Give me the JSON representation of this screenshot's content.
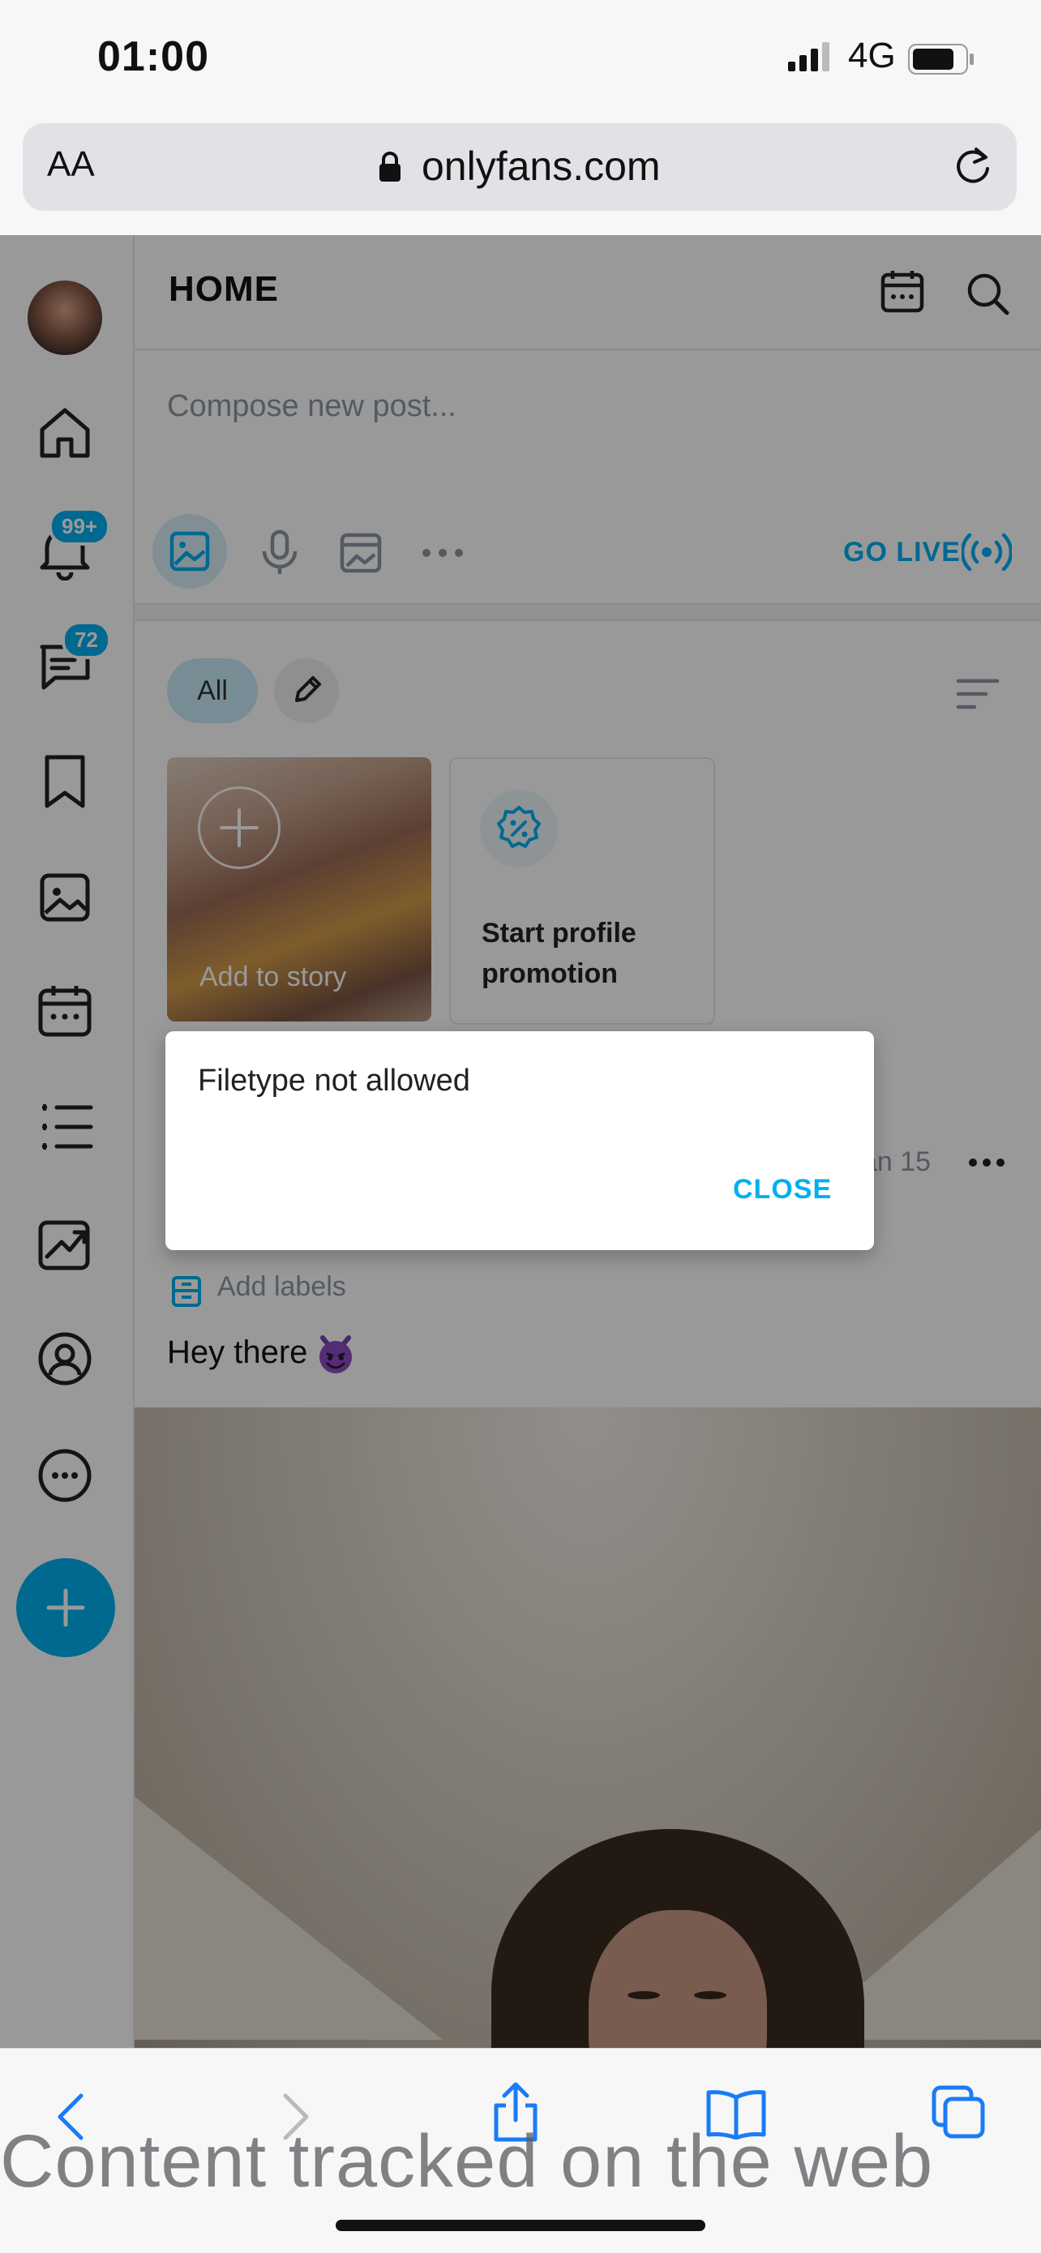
{
  "status_bar": {
    "time": "01:00",
    "network": "4G"
  },
  "browser": {
    "text_size": "AA",
    "url": "onlyfans.com"
  },
  "sidebar": {
    "notifications_badge": "99+",
    "messages_badge": "72",
    "items": [
      "home-icon",
      "bell-icon",
      "chat-icon",
      "bookmark-icon",
      "image-icon",
      "calendar-icon",
      "list-icon",
      "chart-icon",
      "profile-icon",
      "more-icon"
    ]
  },
  "header": {
    "title": "HOME"
  },
  "composer": {
    "placeholder": "Compose new post...",
    "go_live": "GO LIVE"
  },
  "filters": {
    "all_label": "All"
  },
  "stories": {
    "add_label": "Add to story",
    "promo_label": "Start profile promotion"
  },
  "post": {
    "date": "Jan 15",
    "add_labels": "Add labels",
    "caption": "Hey there"
  },
  "dialog": {
    "message": "Filetype not allowed",
    "close_label": "CLOSE"
  },
  "watermark": "Content tracked on the web",
  "colors": {
    "accent": "#00aff0",
    "overlay": "rgba(0,0,0,0.40)",
    "badge": "#00aff0"
  }
}
